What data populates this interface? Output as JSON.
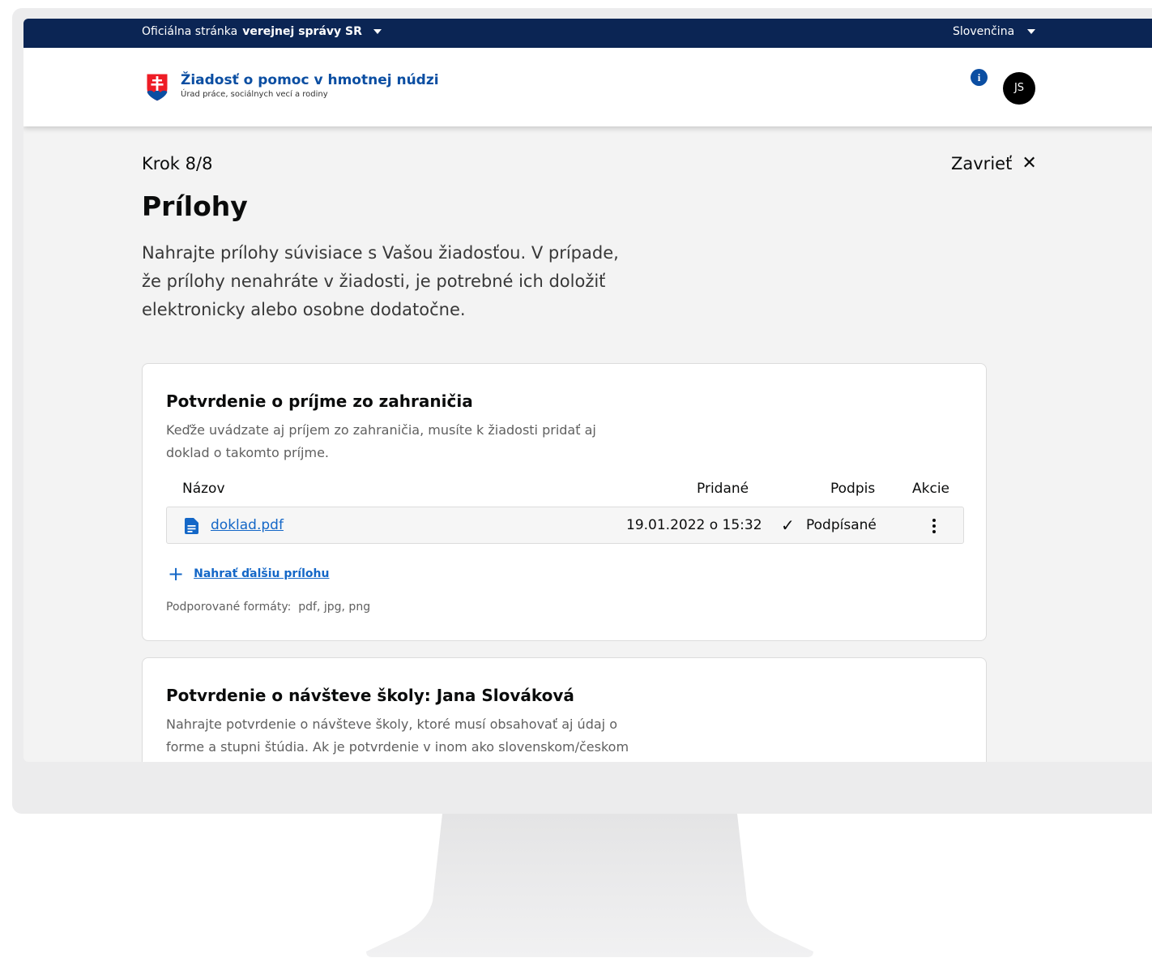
{
  "gov_banner": {
    "prefix": "Oficiálna stránka",
    "bold": "verejnej správy SR",
    "language": "Slovenčina"
  },
  "header": {
    "title": "Žiadosť o pomoc v hmotnej núdzi",
    "subtitle": "Úrad práce, sociálnych vecí a rodiny",
    "avatar_initials": "JS"
  },
  "main": {
    "step": "Krok 8/8",
    "close_label": "Zavrieť",
    "title": "Prílohy",
    "intro": "Nahrajte prílohy súvisiace s Vašou žiadosťou. V prípade, že prílohy nenahráte v žiadosti, je potrebné ich doložiť elektronicky alebo osobne dodatočne."
  },
  "cards": [
    {
      "title": "Potvrdenie o príjme zo zahraničia",
      "description": "Keďže uvádzate aj príjem zo zahraničia, musíte k žiadosti pridať aj doklad o takomto príjme.",
      "columns": [
        "Názov",
        "Pridané",
        "Podpis",
        "Akcie"
      ],
      "files": [
        {
          "name": "doklad.pdf",
          "added": "19.01.2022 o 15:32",
          "signature": "Podpísané"
        }
      ],
      "add_label": "Nahrať ďalšiu prílohu",
      "formats_label": "Podporované formáty:",
      "formats": "pdf, jpg, png"
    },
    {
      "title": "Potvrdenie o návšteve školy: Jana Slováková",
      "description": "Nahrajte potvrdenie o návšteve školy, ktoré musí obsahovať aj údaj o forme a stupni štúdia. Ak je potvrdenie v inom ako slovenskom/českom"
    }
  ],
  "colors": {
    "banner": "#0b2554",
    "brand_blue": "#0b4ea2",
    "link_blue": "#1467c7"
  }
}
